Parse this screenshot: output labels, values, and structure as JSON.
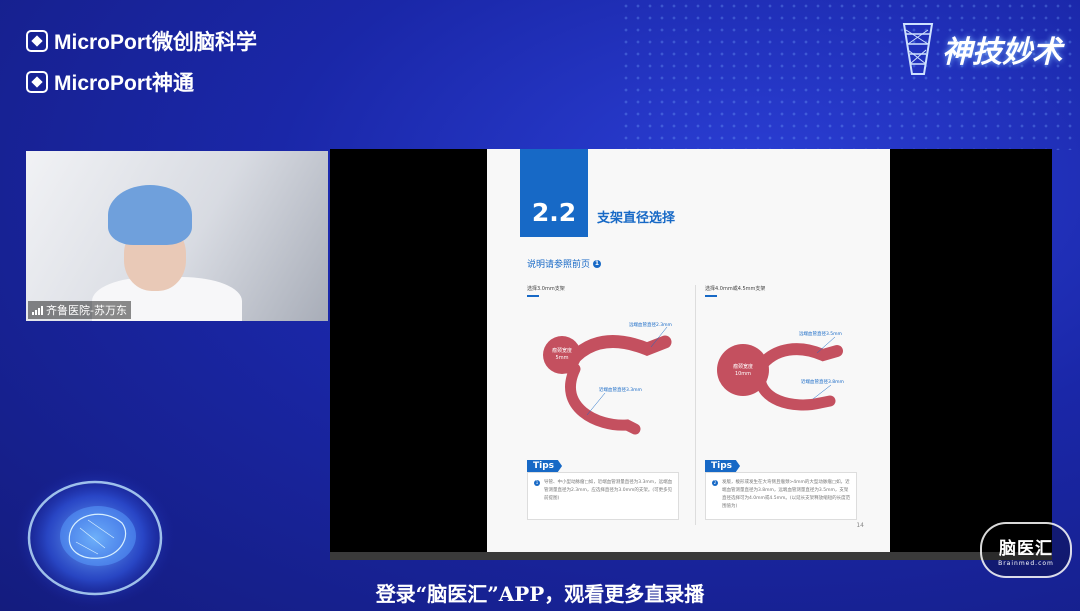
{
  "branding": {
    "logo1_text": "MicroPort微创脑科学",
    "logo2_text": "MicroPort神通",
    "show_title": "神技妙术"
  },
  "webcam": {
    "speaker_label": "齐鲁医院-苏万东"
  },
  "slide": {
    "section_number": "2.2",
    "section_title": "支架直径选择",
    "note_label": "说明请参照前页",
    "note_marker": "1",
    "left_column": {
      "heading": "选择3.0mm支架",
      "aneurysm_label": "瘤颈宽度\n5mm",
      "label_distal": "远端血管直径2.3mm",
      "label_proximal": "近端血管直径3.3mm",
      "tips_title": "Tips",
      "tips_marker": "1",
      "tips_text": "导管、中小型动脉瘤□如，近端血管测量直径为3.3mm，远端血管测量直径为2.3mm，应选择直径为3.0mm的支架。(可更多见前提图)"
    },
    "right_column": {
      "heading": "选择4.0mm或4.5mm支架",
      "aneurysm_label": "瘤颈宽度\n10mm",
      "label_distal": "远端血管直径3.5mm",
      "label_proximal": "近端血管直径3.8mm",
      "tips_title": "Tips",
      "tips_marker": "2",
      "tips_text": "发版，梭形或发生在大弯侧且瘤颈>4mm的大型动脉瘤□如，近端血管测量直径为3.8mm，远端血管测量直径为3.5mm，支架直径选择可为4.0mm或4.5mm。(以延长支架释放缩短的长度范围值为)"
    },
    "page_number": "14"
  },
  "caption": "登录“脑医汇”APP，观看更多直录播",
  "watermark": {
    "title": "脑医汇",
    "subtitle": "Brainmed.com"
  },
  "colors": {
    "background": "#1a27a8",
    "accent_blue": "#1769c6",
    "vessel": "#c4505f"
  }
}
